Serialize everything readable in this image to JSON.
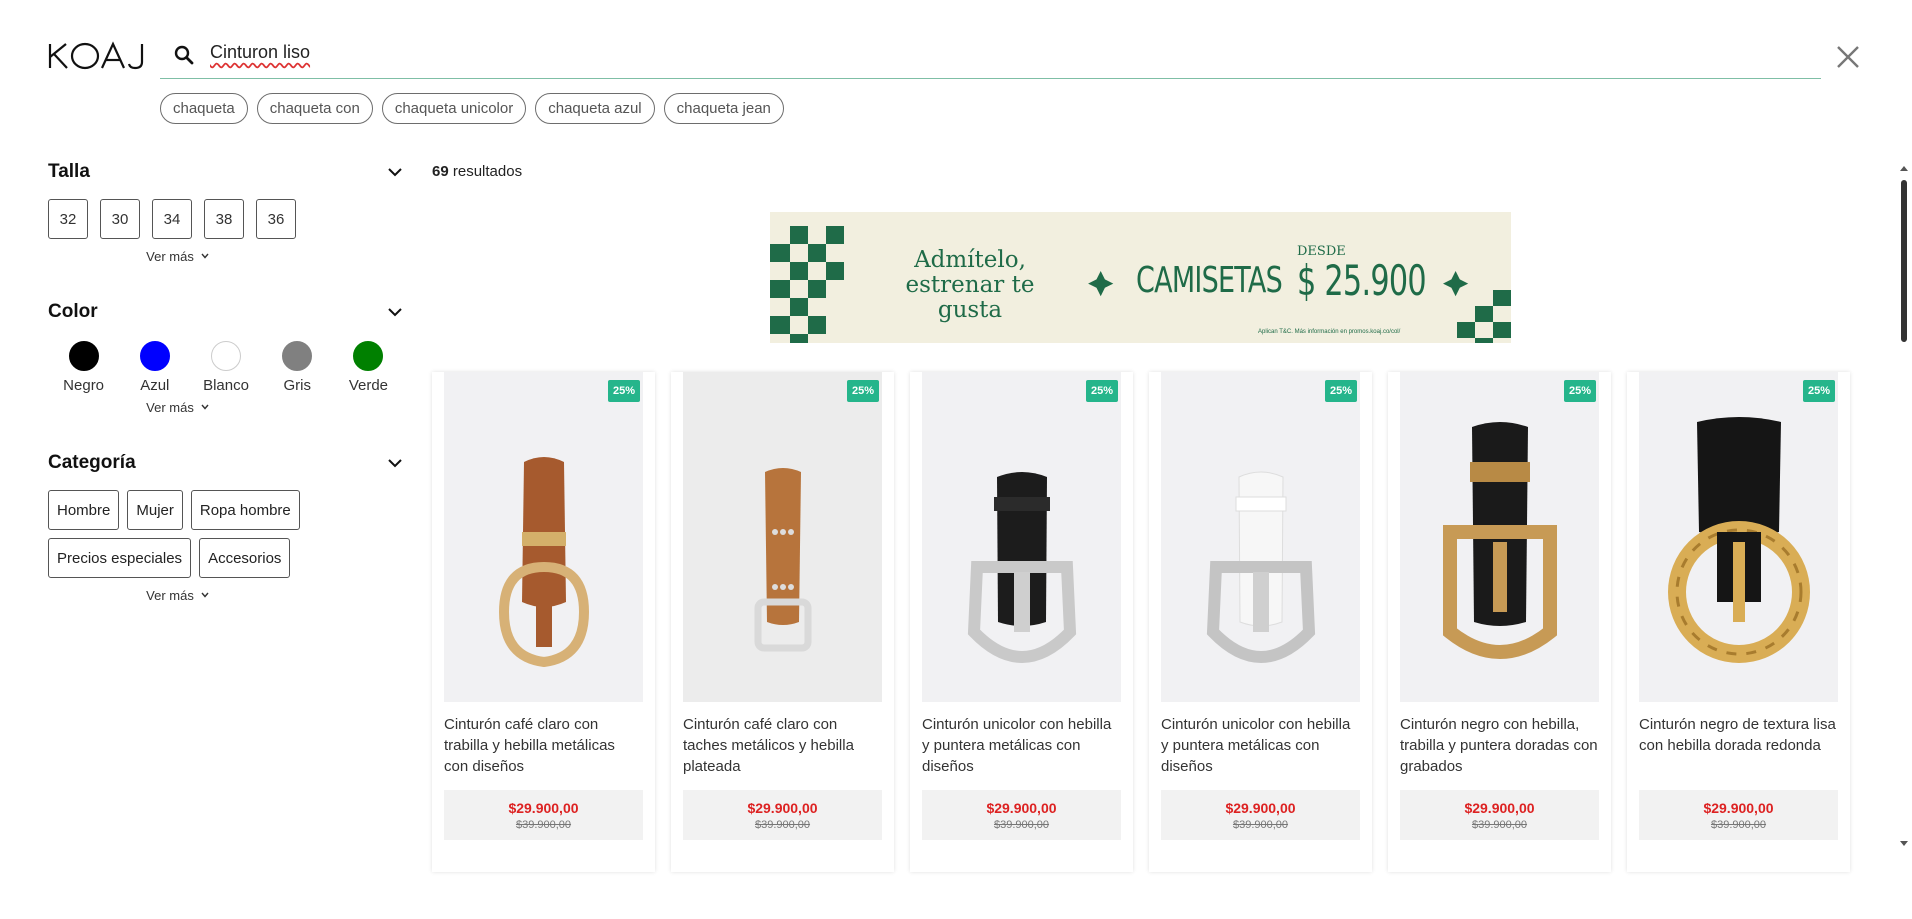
{
  "header": {
    "logo": "KOAJ",
    "search_value": "Cinturon liso",
    "suggestions": [
      "chaqueta",
      "chaqueta con",
      "chaqueta unicolor",
      "chaqueta azul",
      "chaqueta jean"
    ]
  },
  "filters": {
    "talla": {
      "title": "Talla",
      "options": [
        "32",
        "30",
        "34",
        "38",
        "36"
      ],
      "more": "Ver más"
    },
    "color": {
      "title": "Color",
      "options": [
        {
          "label": "Negro",
          "hex": "#000000"
        },
        {
          "label": "Azul",
          "hex": "#0000ff"
        },
        {
          "label": "Blanco",
          "hex": "#ffffff"
        },
        {
          "label": "Gris",
          "hex": "#808080"
        },
        {
          "label": "Verde",
          "hex": "#008000"
        }
      ],
      "more": "Ver más"
    },
    "categoria": {
      "title": "Categoría",
      "options": [
        "Hombre",
        "Mujer",
        "Ropa hombre",
        "Precios especiales",
        "Accesorios"
      ],
      "more": "Ver más"
    }
  },
  "results": {
    "count": "69",
    "label": "resultados"
  },
  "banner": {
    "line1": "Admítelo,",
    "line2": "estrenar te gusta",
    "main": "CAMISETAS",
    "desde": "DESDE",
    "price": "$ 25.900",
    "legal": "Aplican T&C. Más información en promos.koaj.co/col/",
    "accent": "#1f6b48",
    "background": "#f2efdf"
  },
  "products": [
    {
      "badge": "25%",
      "name": "Cinturón café claro con trabilla y hebilla metálicas con diseños",
      "price": "$29.900,00",
      "old_price": "$39.900,00",
      "belt_color": "#a65a2e",
      "buckle": "gold"
    },
    {
      "badge": "25%",
      "name": "Cinturón café claro con taches metálicos y hebilla plateada",
      "price": "$29.900,00",
      "old_price": "$39.900,00",
      "belt_color": "#b7743c",
      "buckle": "silver"
    },
    {
      "badge": "25%",
      "name": "Cinturón unicolor con hebilla y puntera metálicas con diseños",
      "price": "$29.900,00",
      "old_price": "$39.900,00",
      "belt_color": "#1c1c1c",
      "buckle": "silver"
    },
    {
      "badge": "25%",
      "name": "Cinturón unicolor con hebilla y puntera metálicas con diseños",
      "price": "$29.900,00",
      "old_price": "$39.900,00",
      "belt_color": "#f4f4f4",
      "buckle": "silver"
    },
    {
      "badge": "25%",
      "name": "Cinturón negro con hebilla, trabilla y puntera doradas con grabados",
      "price": "$29.900,00",
      "old_price": "$39.900,00",
      "belt_color": "#1a1a1a",
      "buckle": "gold"
    },
    {
      "badge": "25%",
      "name": "Cinturón negro de textura lisa con hebilla dorada redonda",
      "price": "$29.900,00",
      "old_price": "$39.900,00",
      "belt_color": "#151515",
      "buckle": "gold-round"
    }
  ],
  "colors": {
    "badge": "#25b58b",
    "sale_price": "#dd2222",
    "search_underline": "#7fbfa6"
  }
}
